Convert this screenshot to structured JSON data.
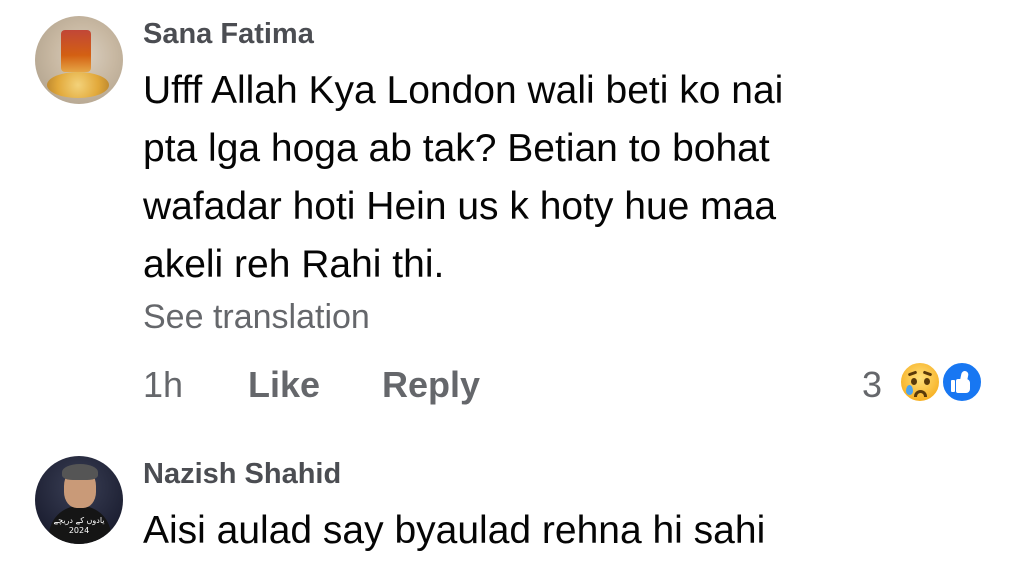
{
  "comments": [
    {
      "author": "Sana Fatima",
      "avatar_icon": "profile-photo",
      "lines": [
        "Ufff Allah Kya London wali beti ko nai",
        "pta lga hoga ab tak? Betian to bohat",
        "wafadar hoti Hein us k hoty hue maa",
        "akeli reh Rahi thi."
      ],
      "see_translation": "See translation",
      "time": "1h",
      "like_label": "Like",
      "reply_label": "Reply",
      "reaction_count": "3",
      "reaction_icons": [
        "sad-reaction-icon",
        "like-reaction-icon"
      ]
    },
    {
      "author": "Nazish Shahid",
      "avatar_icon": "profile-photo",
      "avatar_caption": [
        "یادوں کے دریچے",
        "2024"
      ],
      "lines": [
        "Aisi aulad say byaulad rehna hi sahi"
      ]
    }
  ],
  "colors": {
    "author": "#4b4d52",
    "text": "#050505",
    "meta": "#65676b",
    "like_blue": "#1877f2",
    "sad_yellow": "#f7b125"
  }
}
